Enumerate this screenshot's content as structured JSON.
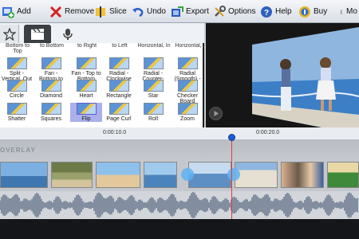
{
  "toolbar": {
    "add": "Add",
    "remove": "Remove",
    "slice": "Slice",
    "undo": "Undo",
    "export": "Export",
    "options": "Options",
    "help": "Help",
    "buy": "Buy",
    "more": "Mo"
  },
  "tabs": {
    "star": "star-icon",
    "transitions": "clapperboard-icon",
    "audio": "microphone-icon"
  },
  "cut_labels": [
    "Bottom to Top",
    "to Bottom",
    "to Right",
    "to Left",
    "Horizontal, In",
    "Horizontal,"
  ],
  "transitions": [
    {
      "label": "Split - Vertical, Out"
    },
    {
      "label": "Fan - Bottom to Top"
    },
    {
      "label": "Fan - Top to Bottom"
    },
    {
      "label": "Radial - Clockwise"
    },
    {
      "label": "Radial - Counter-"
    },
    {
      "label": "Radial (Smooth) -"
    },
    {
      "label": "Circle"
    },
    {
      "label": "Diamond"
    },
    {
      "label": "Heart"
    },
    {
      "label": "Rectangle"
    },
    {
      "label": "Star"
    },
    {
      "label": "Checker Board"
    },
    {
      "label": "Shatter"
    },
    {
      "label": "Squares"
    },
    {
      "label": "Flip"
    },
    {
      "label": "Page Curl"
    },
    {
      "label": "Roll"
    },
    {
      "label": "Zoom"
    }
  ],
  "selected_transition": "Flip",
  "timeline": {
    "tick1": "0:00:10.0",
    "tick2": "0:00:20.0",
    "overlay_label": "OVERLAY"
  },
  "colors": {
    "accent": "#5a5fd0",
    "playhead": "#e23b3b"
  }
}
